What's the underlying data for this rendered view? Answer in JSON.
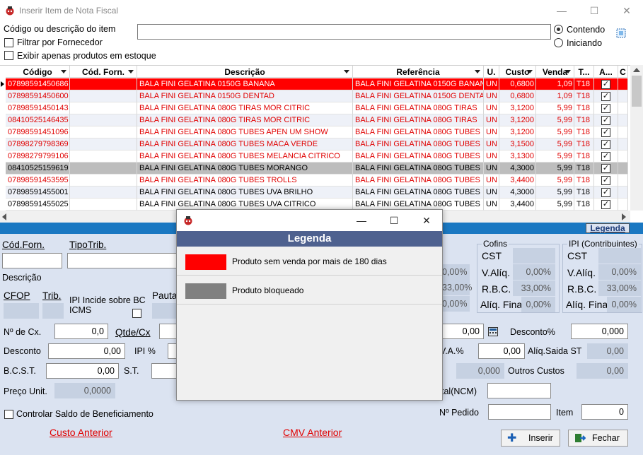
{
  "window": {
    "title": "Inserir Item de Nota Fiscal",
    "min": "—",
    "max": "☐",
    "close": "✕"
  },
  "search": {
    "label": "Código ou descrição do item",
    "value": "",
    "filtrar_fornecedor": "Filtrar por Fornecedor",
    "exibir_estoque": "Exibir apenas produtos em estoque",
    "opt_contendo": "Contendo",
    "opt_iniciando": "Iniciando",
    "selected_option": "Contendo"
  },
  "grid": {
    "columns": [
      {
        "label": "Código"
      },
      {
        "label": "Cód. Forn."
      },
      {
        "label": "Descrição"
      },
      {
        "label": "Referência"
      },
      {
        "label": "U."
      },
      {
        "label": "Custo"
      },
      {
        "label": "Venda"
      },
      {
        "label": "T..."
      },
      {
        "label": "A..."
      },
      {
        "label": "C"
      }
    ],
    "rows": [
      {
        "codigo": "07898591450686",
        "desc": "BALA FINI GELATINA 0150G BANANA",
        "ref": "BALA FINI GELATINA 0150G BANAN",
        "un": "UN",
        "custo": "0,6800",
        "venda": "1,09",
        "trib": "T18",
        "status": "selected"
      },
      {
        "codigo": "07898591450600",
        "desc": "BALA FINI GELATINA 0150G DENTAD",
        "ref": "BALA FINI GELATINA 0150G DENTA",
        "un": "UN",
        "custo": "0,6800",
        "venda": "1,09",
        "trib": "T18",
        "status": "nosale"
      },
      {
        "codigo": "07898591450143",
        "desc": "BALA FINI GELATINA 080G TIRAS MOR CITRIC",
        "ref": "BALA FINI GELATINA 080G TIRAS",
        "un": "UN",
        "custo": "3,1200",
        "venda": "5,99",
        "trib": "T18",
        "status": "nosale"
      },
      {
        "codigo": "08410525146435",
        "desc": "BALA FINI GELATINA 080G TIRAS MOR CITRIC",
        "ref": "BALA FINI GELATINA 080G TIRAS",
        "un": "UN",
        "custo": "3,1200",
        "venda": "5,99",
        "trib": "T18",
        "status": "nosale"
      },
      {
        "codigo": "07898591451096",
        "desc": "BALA FINI GELATINA 080G TUBES APEN UM SHOW",
        "ref": "BALA FINI GELATINA 080G TUBES",
        "un": "UN",
        "custo": "3,1200",
        "venda": "5,99",
        "trib": "T18",
        "status": "nosale"
      },
      {
        "codigo": "07898279798369",
        "desc": "BALA FINI GELATINA 080G TUBES MACA VERDE",
        "ref": "BALA FINI GELATINA 080G TUBES",
        "un": "UN",
        "custo": "3,1500",
        "venda": "5,99",
        "trib": "T18",
        "status": "nosale"
      },
      {
        "codigo": "07898279799106",
        "desc": "BALA FINI GELATINA 080G TUBES MELANCIA CITRICO",
        "ref": "BALA FINI GELATINA 080G TUBES",
        "un": "UN",
        "custo": "3,1300",
        "venda": "5,99",
        "trib": "T18",
        "status": "nosale"
      },
      {
        "codigo": "08410525159619",
        "desc": "BALA FINI GELATINA 080G TUBES MORANGO",
        "ref": "BALA FINI GELATINA 080G TUBES",
        "un": "UN",
        "custo": "4,3000",
        "venda": "5,99",
        "trib": "T18",
        "status": "blocked"
      },
      {
        "codigo": "07898591453595",
        "desc": "BALA FINI GELATINA 080G TUBES TROLLS",
        "ref": "BALA FINI GELATINA 080G TUBES",
        "un": "UN",
        "custo": "3,4400",
        "venda": "5,99",
        "trib": "T18",
        "status": "nosale"
      },
      {
        "codigo": "07898591455001",
        "desc": "BALA FINI GELATINA 080G TUBES UVA BRILHO",
        "ref": "BALA FINI GELATINA 080G TUBES",
        "un": "UN",
        "custo": "4,3000",
        "venda": "5,99",
        "trib": "T18",
        "status": "normal"
      },
      {
        "codigo": "07898591455025",
        "desc": "BALA FINI GELATINA 080G TUBES UVA CITRICO",
        "ref": "BALA FINI GELATINA 080G TUBES",
        "un": "UN",
        "custo": "3,4400",
        "venda": "5,99",
        "trib": "T18",
        "status": "normal"
      }
    ]
  },
  "legenda_button": "Legenda",
  "form": {
    "cod_forn": "Cód.Forn.",
    "tipo_trib": "TipoTrib.",
    "descricao": "Descrição",
    "cfop": "CFOP",
    "trib": "Trib.",
    "ipi_incide": "IPI Incide sobre BC ICMS",
    "pauta": "Pauta",
    "num_cx": "Nº de Cx.",
    "num_cx_val": "0,0",
    "qtde_cx": "Qtde/Cx",
    "desconto": "Desconto",
    "desconto_val": "0,00",
    "ipi_pct": "IPI %",
    "bcst": "B.C.S.T.",
    "bcst_val": "0,00",
    "st": "S.T.",
    "preco_unit": "Preço Unit.",
    "preco_unit_val": "0,0000",
    "controlar": "Controlar Saldo de Beneficiamento",
    "custo_anterior": "Custo Anterior",
    "cmv_anterior": "CMV Anterior",
    "total_val": "0,00",
    "desconto_pct": "Desconto%",
    "desconto_pct_val": "0,000",
    "iva": "V.A.%",
    "iva_val": "0,00",
    "aliq_saida_st": "Alíq.Saida ST",
    "aliq_saida_st_val": "0,00",
    "outros_val_ro": "0,000",
    "outros_custos": "Outros Custos",
    "outros_custos_val": "0,00",
    "ncm_label": "tal(NCM)",
    "num_pedido": "Nº Pedido",
    "item": "Item",
    "item_val": "0",
    "icms_vals": [
      "0,00%",
      "33,00%",
      "0,00%"
    ],
    "cofins": {
      "title": "Cofins",
      "cst": "CST",
      "valiq": "V.Alíq.",
      "rbc": "R.B.C.",
      "aliq_final": "Alíq. Final",
      "valiq_val": "0,00%",
      "rbc_val": "33,00%",
      "aliq_final_val": "0,00%"
    },
    "ipi": {
      "title": "IPI (Contribuintes)",
      "cst": "CST",
      "valiq": "V.Alíq.",
      "rbc": "R.B.C.",
      "aliq_final": "Alíq. Final",
      "valiq_val": "0,00%",
      "rbc_val": "33,00%",
      "aliq_final_val": "0,00%"
    },
    "inserir": "Inserir",
    "fechar": "Fechar"
  },
  "modal": {
    "title": "Legenda",
    "items": [
      {
        "color": "#ff0000",
        "label": "Produto sem venda por mais de 180 dias"
      },
      {
        "color": "#808080",
        "label": "Produto bloqueado"
      }
    ]
  },
  "colors": {
    "selected_row": "#ff0000",
    "nosale_text": "#e00000",
    "blocked_row": "#bdbdbd",
    "accent_blue": "#1a78c2",
    "form_bg": "#dbe3f1",
    "modal_header": "#4e618f"
  }
}
